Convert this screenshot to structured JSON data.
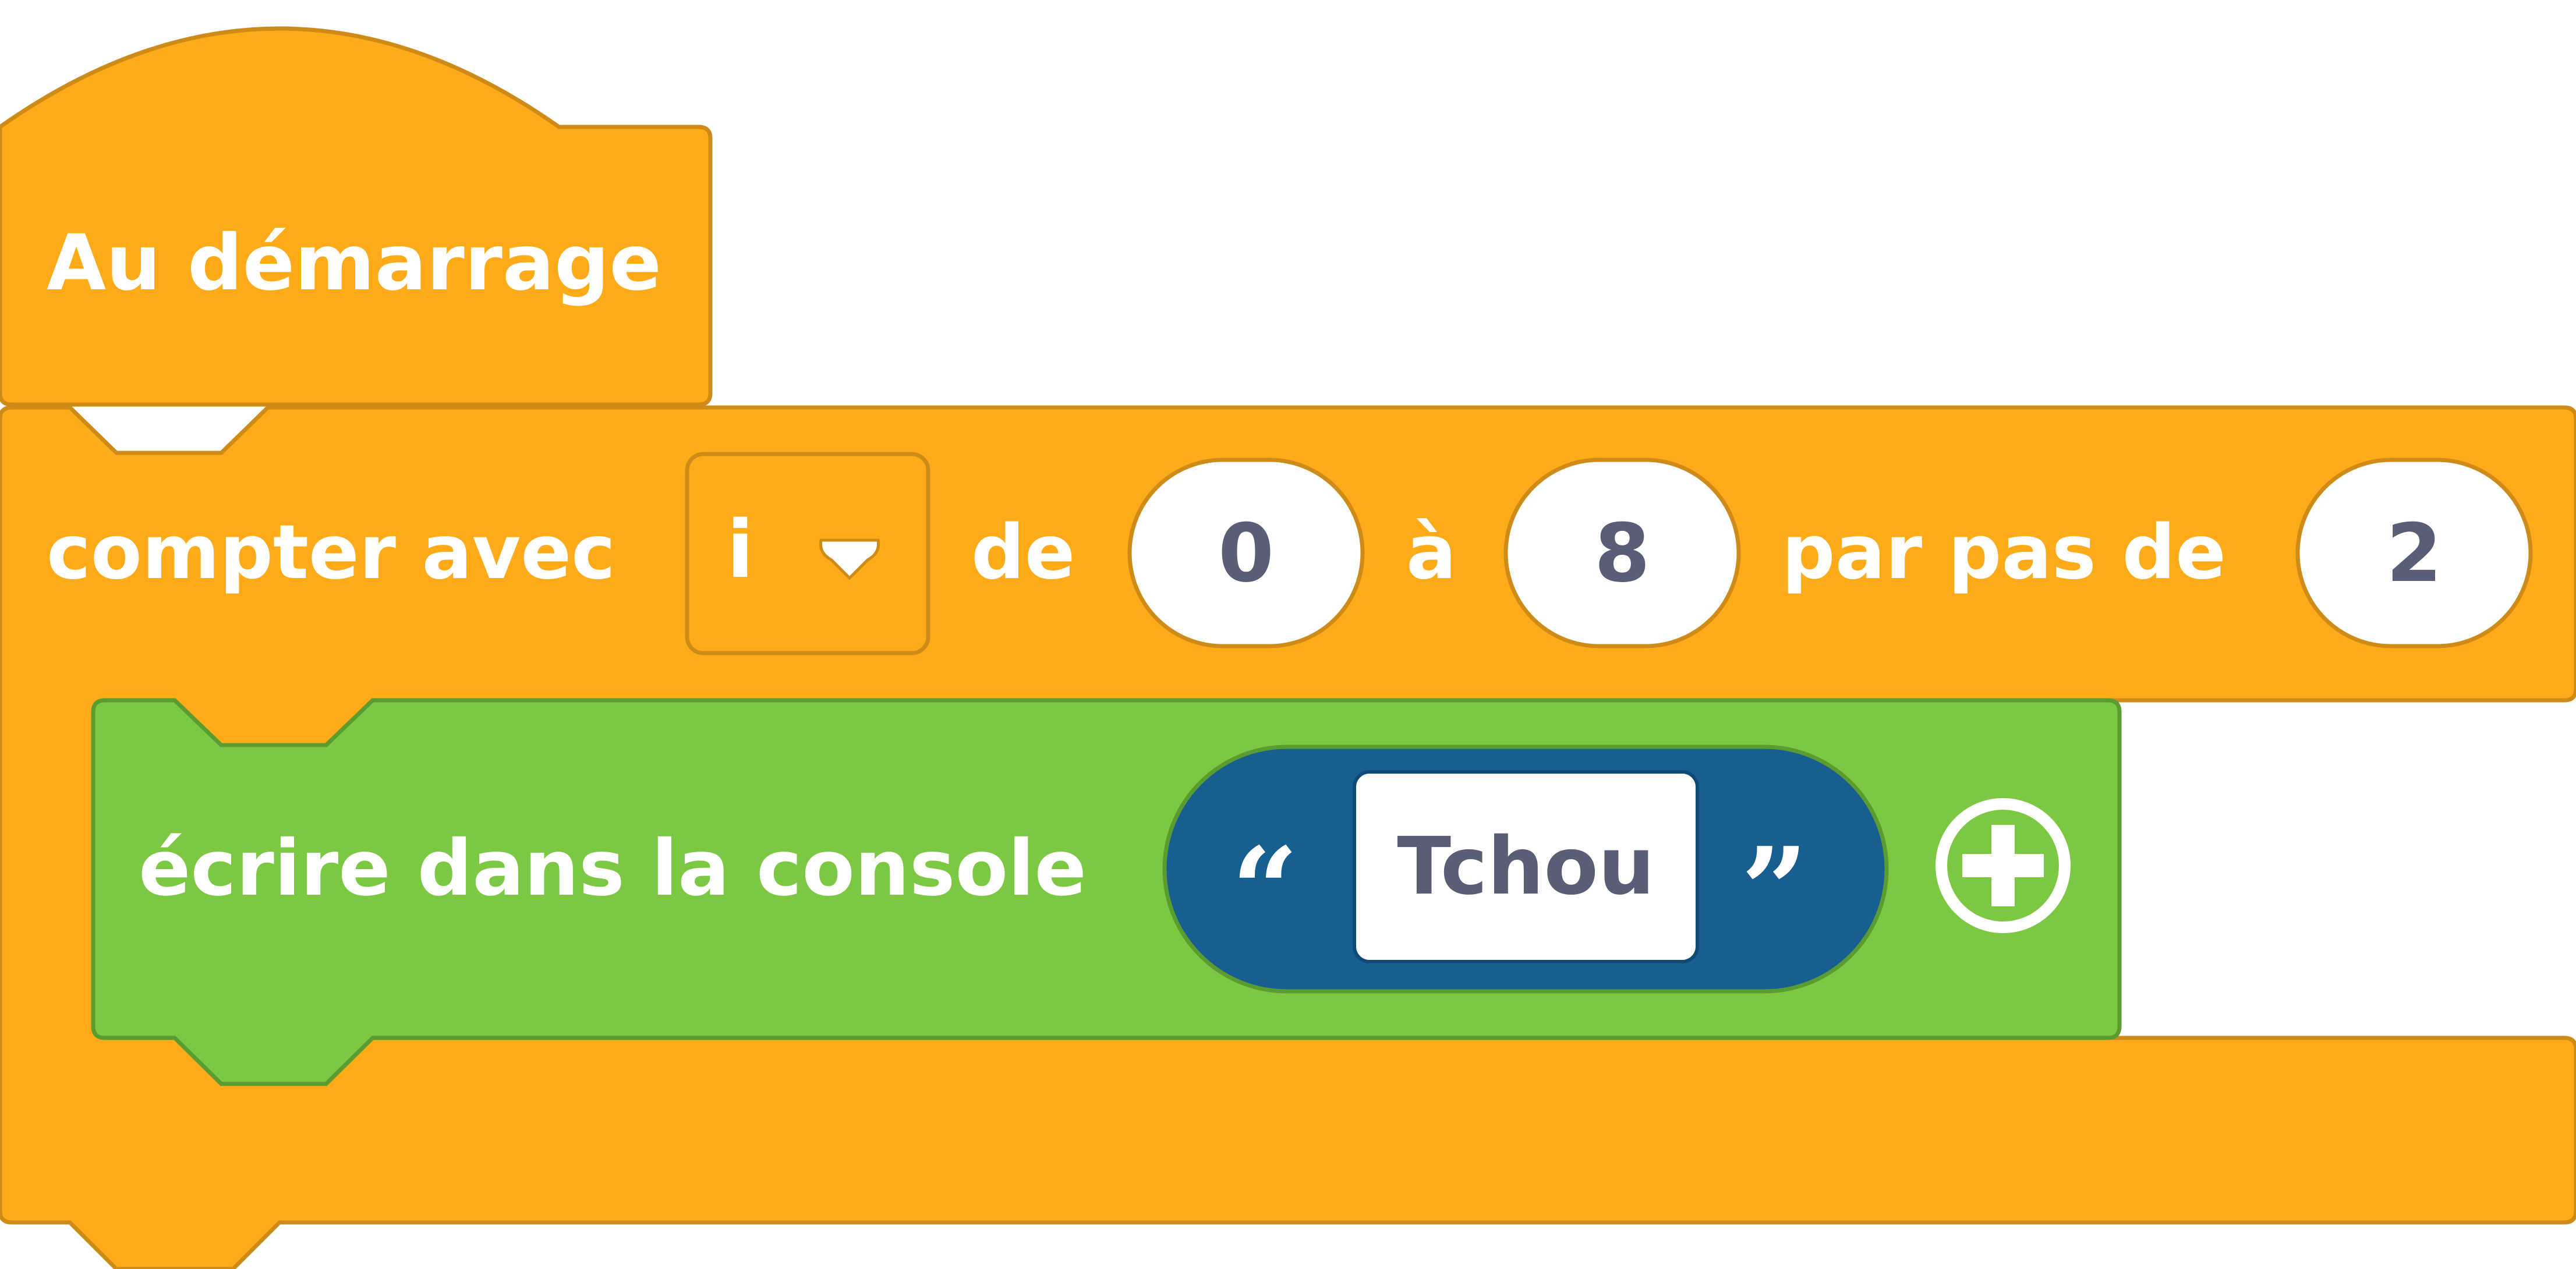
{
  "colors": {
    "events": "#ffab19",
    "events_border": "#cf8b17",
    "console": "#7cc843",
    "console_border": "#5b9c30",
    "text_input": "#175e91",
    "text_input_border": "#0e4a73",
    "field_text": "#575e75"
  },
  "icons": {
    "dropdown": "chevron-down-icon",
    "add": "plus-circle-icon",
    "quote_open": "open-quote-icon",
    "quote_close": "close-quote-icon"
  },
  "hat_block": {
    "label": "Au démarrage"
  },
  "loop_block": {
    "label_count": "compter avec",
    "variable": "i",
    "label_from": "de",
    "from_value": "0",
    "label_to": "à",
    "to_value": "8",
    "label_step": "par pas de",
    "step_value": "2"
  },
  "console_block": {
    "label": "écrire dans la console",
    "open_quote": "“",
    "text_value": "Tchou",
    "close_quote": "”"
  }
}
